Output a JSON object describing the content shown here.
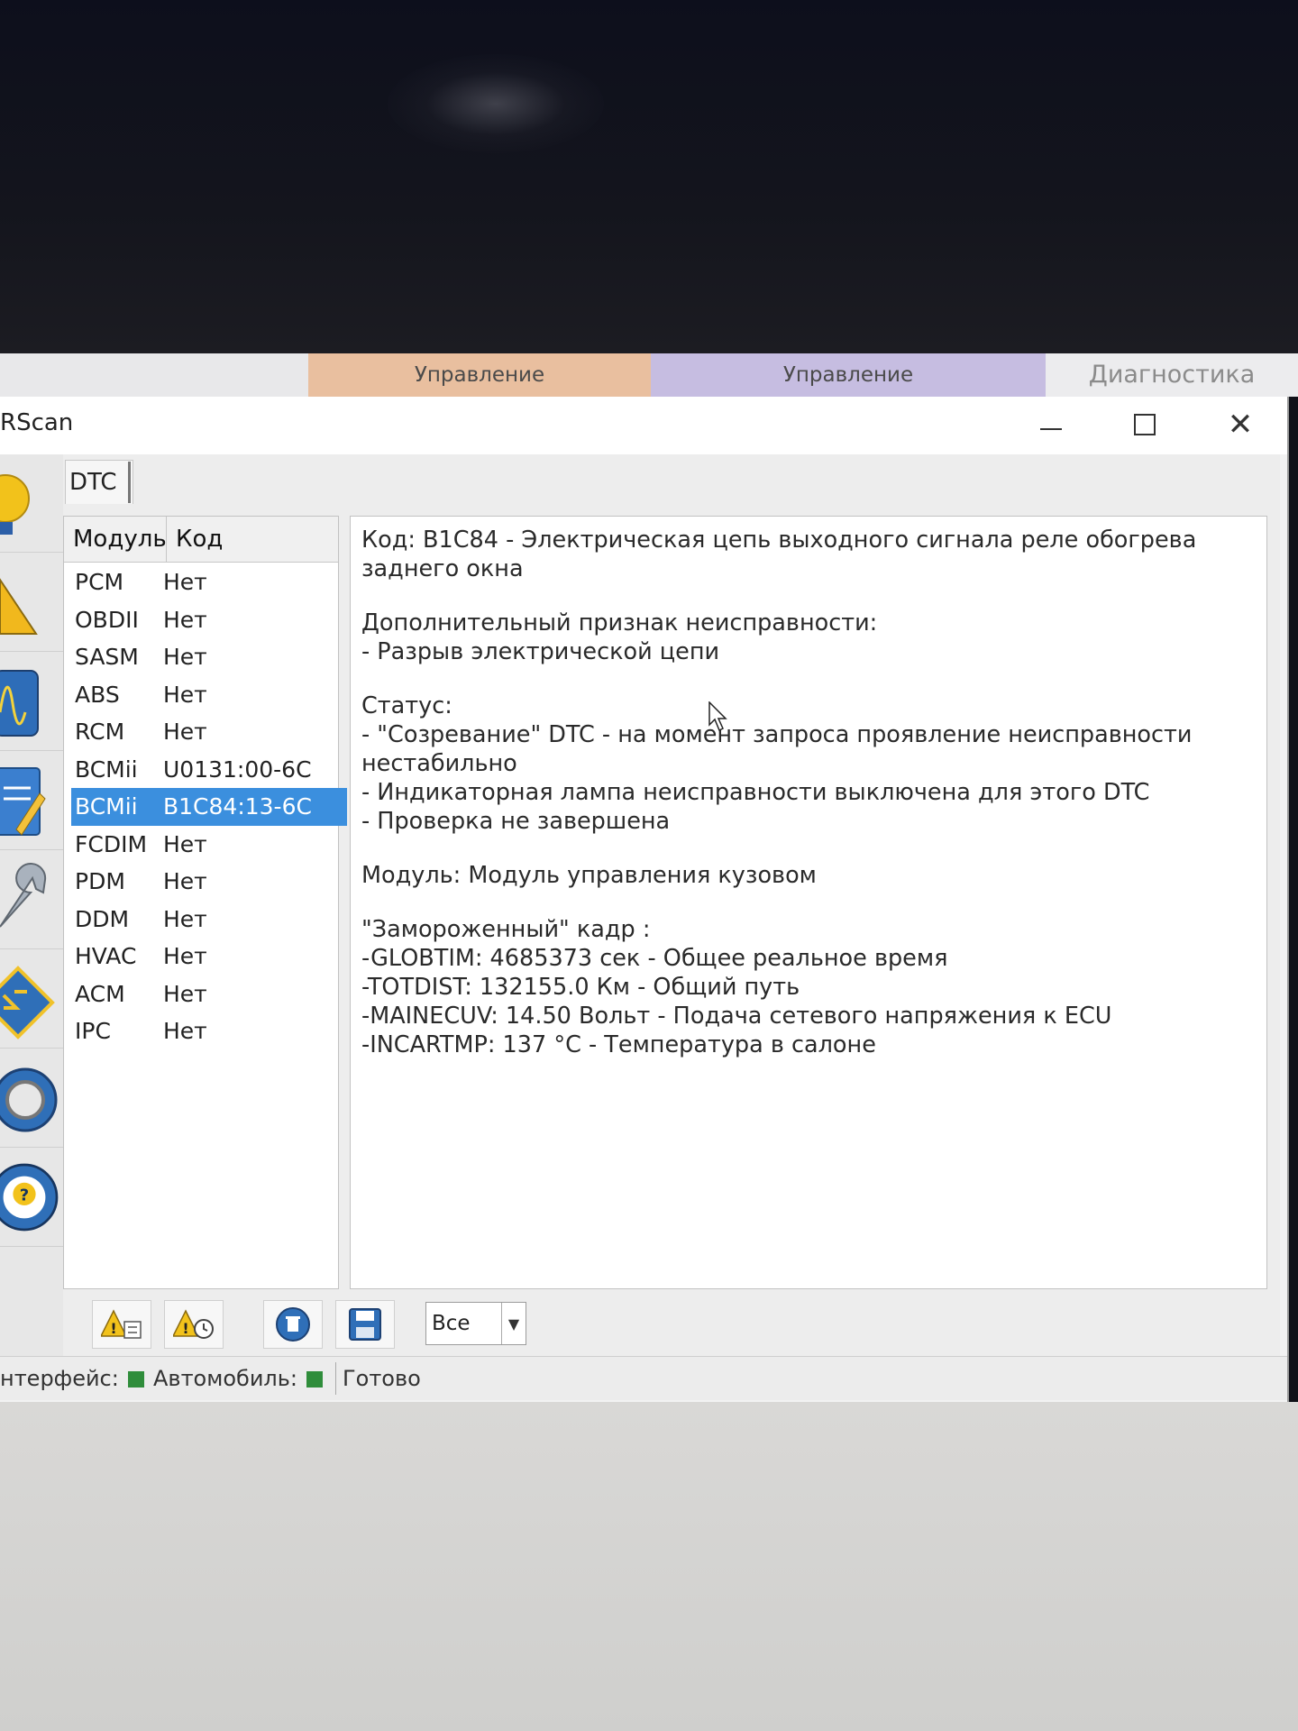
{
  "top_tabs": [
    "Управление",
    "Управление",
    "Диагностика"
  ],
  "window": {
    "title": "RScan"
  },
  "dtc_tab": {
    "label": "DTC"
  },
  "modules": {
    "headers": [
      "Модуль",
      "Код"
    ],
    "rows": [
      {
        "module": "PCM",
        "code": "Нет"
      },
      {
        "module": "OBDII",
        "code": "Нет"
      },
      {
        "module": "SASM",
        "code": "Нет"
      },
      {
        "module": "ABS",
        "code": "Нет"
      },
      {
        "module": "RCM",
        "code": "Нет"
      },
      {
        "module": "BCMii",
        "code": "U0131:00-6C"
      },
      {
        "module": "BCMii",
        "code": "B1C84:13-6C",
        "selected": true
      },
      {
        "module": "FCDIM",
        "code": "Нет"
      },
      {
        "module": "PDM",
        "code": "Нет"
      },
      {
        "module": "DDM",
        "code": "Нет"
      },
      {
        "module": "HVAC",
        "code": "Нет"
      },
      {
        "module": "ACM",
        "code": "Нет"
      },
      {
        "module": "IPC",
        "code": "Нет"
      }
    ]
  },
  "detail": {
    "code_line": "Код: B1C84 - Электрическая цепь выходного сигнала реле обогрева заднего окна",
    "extra_title": "Дополнительный признак неисправности:",
    "extra_item": " - Разрыв электрической цепи",
    "status_title": "Статус:",
    "status_1": " - \"Созревание\" DTC - на момент запроса проявление неисправности нестабильно",
    "status_2": " - Индикаторная лампа неисправности выключена для этого DTC",
    "status_3": " - Проверка не завершена",
    "module_line": "Модуль: Модуль управления кузовом",
    "frame_title": " \"Замороженный\" кадр :",
    "frame_1": "-GLOBTIM: 4685373 сек - Общее реальное время",
    "frame_2": "-TOTDIST: 132155.0 Км - Общий путь",
    "frame_3": "-MAINECUV: 14.50 Вольт - Подача сетевого напряжения к ECU",
    "frame_4": "-INCARTMP: 137 °C - Температура в салоне"
  },
  "toolbar": {
    "filter_value": "Все"
  },
  "status": {
    "interface_label": "нтерфейс:",
    "vehicle_label": "Автомобиль:",
    "ready_text": "Готово"
  },
  "colors": {
    "selection": "#3b8fde",
    "led": "#2f8d3b",
    "tab_orange": "#e9bf9f",
    "tab_purple": "#c6bde1"
  }
}
